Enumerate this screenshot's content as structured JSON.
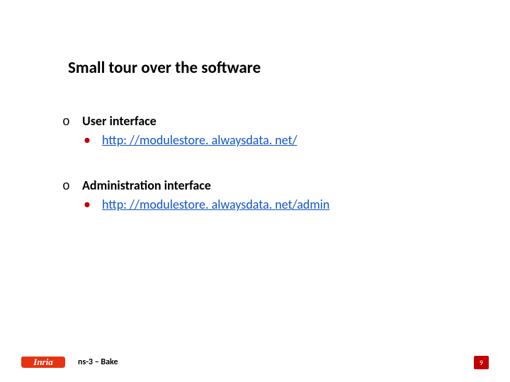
{
  "title": "Small tour over the software",
  "sections": [
    {
      "heading": "User interface",
      "link": "http: //modulestore. alwaysdata. net/"
    },
    {
      "heading": "Administration interface",
      "link": "http: //modulestore. alwaysdata. net/admin"
    }
  ],
  "footer": {
    "title": "ns-3 – Bake",
    "page": "9"
  },
  "bullet_marker": "o"
}
